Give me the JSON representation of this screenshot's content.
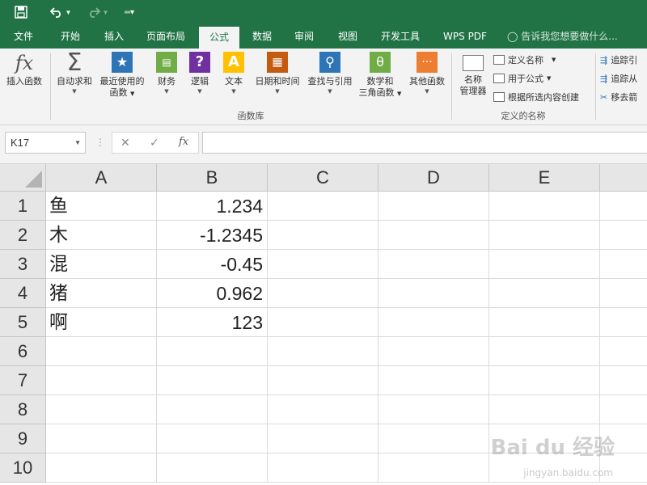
{
  "quick_access": {
    "save_icon": "save-icon",
    "undo_icon": "undo-icon",
    "redo_icon": "redo-icon",
    "customize_icon": "customize-qat-icon"
  },
  "tabs": [
    {
      "label": "文件"
    },
    {
      "label": "开始"
    },
    {
      "label": "插入"
    },
    {
      "label": "页面布局"
    },
    {
      "label": "公式"
    },
    {
      "label": "数据"
    },
    {
      "label": "审阅"
    },
    {
      "label": "视图"
    },
    {
      "label": "开发工具"
    },
    {
      "label": "WPS PDF"
    }
  ],
  "active_tab": "公式",
  "tell_me": "告诉我您想要做什么...",
  "ribbon": {
    "insert_function": "插入函数",
    "autosum": "自动求和",
    "recent_line1": "最近使用的",
    "recent_line2": "函数",
    "financial": "财务",
    "logical": "逻辑",
    "text": "文本",
    "datetime": "日期和时间",
    "lookup": "查找与引用",
    "math_line1": "数学和",
    "math_line2": "三角函数",
    "other": "其他函数",
    "function_library_label": "函数库",
    "name_manager_line1": "名称",
    "name_manager_line2": "管理器",
    "define_name": "定义名称",
    "use_in_formula": "用于公式",
    "create_from_selection": "根据所选内容创建",
    "defined_names_label": "定义的名称",
    "trace_precedents": "追踪引",
    "trace_dependents": "追踪从",
    "remove_arrows": "移去箭"
  },
  "formula_bar": {
    "name_box": "K17",
    "cancel": "✕",
    "enter": "✓",
    "fx": "fx",
    "value": ""
  },
  "columns": [
    "A",
    "B",
    "C",
    "D",
    "E"
  ],
  "rows": [
    {
      "num": "1",
      "a": "鱼",
      "b": "1.234"
    },
    {
      "num": "2",
      "a": "木",
      "b": "-1.2345"
    },
    {
      "num": "3",
      "a": "混",
      "b": "-0.45"
    },
    {
      "num": "4",
      "a": "猪",
      "b": "0.962"
    },
    {
      "num": "5",
      "a": "啊",
      "b": "123"
    },
    {
      "num": "6",
      "a": "",
      "b": ""
    },
    {
      "num": "7",
      "a": "",
      "b": ""
    },
    {
      "num": "8",
      "a": "",
      "b": ""
    },
    {
      "num": "9",
      "a": "",
      "b": ""
    },
    {
      "num": "10",
      "a": "",
      "b": ""
    }
  ],
  "watermark": {
    "main": "Bai du 经验",
    "sub": "jingyan.baidu.com"
  },
  "colors": {
    "brand": "#217346",
    "ribbon_bg": "#f3f3f3",
    "header_bg": "#e6e6e6"
  }
}
